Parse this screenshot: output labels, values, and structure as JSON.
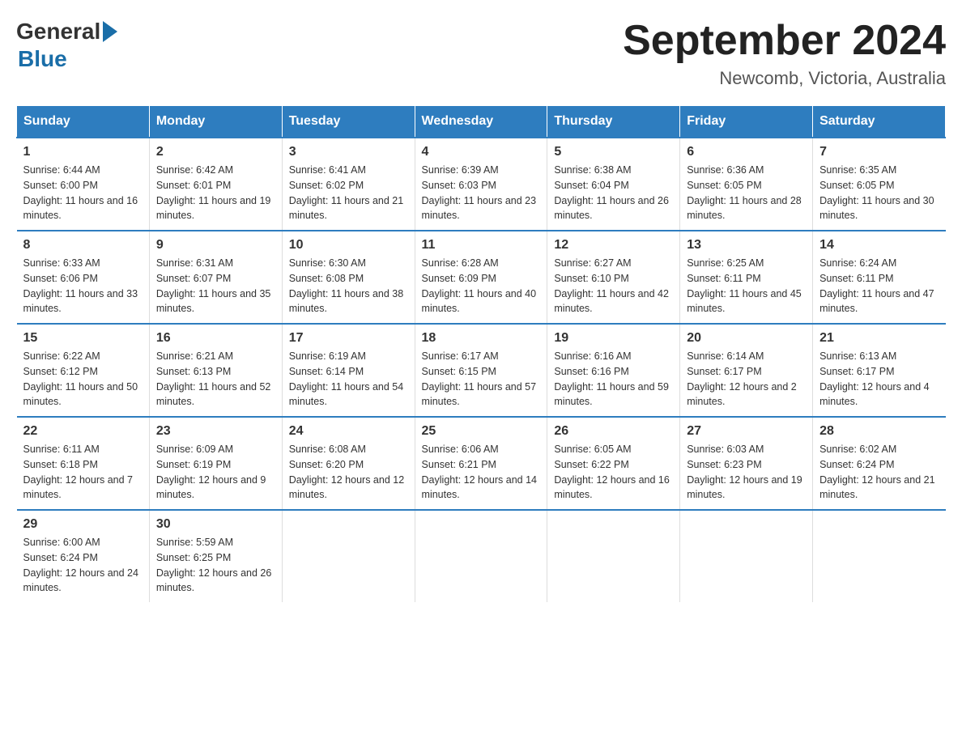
{
  "logo": {
    "text_general": "General",
    "text_blue": "Blue"
  },
  "title": "September 2024",
  "location": "Newcomb, Victoria, Australia",
  "days_header": [
    "Sunday",
    "Monday",
    "Tuesday",
    "Wednesday",
    "Thursday",
    "Friday",
    "Saturday"
  ],
  "weeks": [
    [
      {
        "num": "1",
        "sunrise": "6:44 AM",
        "sunset": "6:00 PM",
        "daylight": "11 hours and 16 minutes."
      },
      {
        "num": "2",
        "sunrise": "6:42 AM",
        "sunset": "6:01 PM",
        "daylight": "11 hours and 19 minutes."
      },
      {
        "num": "3",
        "sunrise": "6:41 AM",
        "sunset": "6:02 PM",
        "daylight": "11 hours and 21 minutes."
      },
      {
        "num": "4",
        "sunrise": "6:39 AM",
        "sunset": "6:03 PM",
        "daylight": "11 hours and 23 minutes."
      },
      {
        "num": "5",
        "sunrise": "6:38 AM",
        "sunset": "6:04 PM",
        "daylight": "11 hours and 26 minutes."
      },
      {
        "num": "6",
        "sunrise": "6:36 AM",
        "sunset": "6:05 PM",
        "daylight": "11 hours and 28 minutes."
      },
      {
        "num": "7",
        "sunrise": "6:35 AM",
        "sunset": "6:05 PM",
        "daylight": "11 hours and 30 minutes."
      }
    ],
    [
      {
        "num": "8",
        "sunrise": "6:33 AM",
        "sunset": "6:06 PM",
        "daylight": "11 hours and 33 minutes."
      },
      {
        "num": "9",
        "sunrise": "6:31 AM",
        "sunset": "6:07 PM",
        "daylight": "11 hours and 35 minutes."
      },
      {
        "num": "10",
        "sunrise": "6:30 AM",
        "sunset": "6:08 PM",
        "daylight": "11 hours and 38 minutes."
      },
      {
        "num": "11",
        "sunrise": "6:28 AM",
        "sunset": "6:09 PM",
        "daylight": "11 hours and 40 minutes."
      },
      {
        "num": "12",
        "sunrise": "6:27 AM",
        "sunset": "6:10 PM",
        "daylight": "11 hours and 42 minutes."
      },
      {
        "num": "13",
        "sunrise": "6:25 AM",
        "sunset": "6:11 PM",
        "daylight": "11 hours and 45 minutes."
      },
      {
        "num": "14",
        "sunrise": "6:24 AM",
        "sunset": "6:11 PM",
        "daylight": "11 hours and 47 minutes."
      }
    ],
    [
      {
        "num": "15",
        "sunrise": "6:22 AM",
        "sunset": "6:12 PM",
        "daylight": "11 hours and 50 minutes."
      },
      {
        "num": "16",
        "sunrise": "6:21 AM",
        "sunset": "6:13 PM",
        "daylight": "11 hours and 52 minutes."
      },
      {
        "num": "17",
        "sunrise": "6:19 AM",
        "sunset": "6:14 PM",
        "daylight": "11 hours and 54 minutes."
      },
      {
        "num": "18",
        "sunrise": "6:17 AM",
        "sunset": "6:15 PM",
        "daylight": "11 hours and 57 minutes."
      },
      {
        "num": "19",
        "sunrise": "6:16 AM",
        "sunset": "6:16 PM",
        "daylight": "11 hours and 59 minutes."
      },
      {
        "num": "20",
        "sunrise": "6:14 AM",
        "sunset": "6:17 PM",
        "daylight": "12 hours and 2 minutes."
      },
      {
        "num": "21",
        "sunrise": "6:13 AM",
        "sunset": "6:17 PM",
        "daylight": "12 hours and 4 minutes."
      }
    ],
    [
      {
        "num": "22",
        "sunrise": "6:11 AM",
        "sunset": "6:18 PM",
        "daylight": "12 hours and 7 minutes."
      },
      {
        "num": "23",
        "sunrise": "6:09 AM",
        "sunset": "6:19 PM",
        "daylight": "12 hours and 9 minutes."
      },
      {
        "num": "24",
        "sunrise": "6:08 AM",
        "sunset": "6:20 PM",
        "daylight": "12 hours and 12 minutes."
      },
      {
        "num": "25",
        "sunrise": "6:06 AM",
        "sunset": "6:21 PM",
        "daylight": "12 hours and 14 minutes."
      },
      {
        "num": "26",
        "sunrise": "6:05 AM",
        "sunset": "6:22 PM",
        "daylight": "12 hours and 16 minutes."
      },
      {
        "num": "27",
        "sunrise": "6:03 AM",
        "sunset": "6:23 PM",
        "daylight": "12 hours and 19 minutes."
      },
      {
        "num": "28",
        "sunrise": "6:02 AM",
        "sunset": "6:24 PM",
        "daylight": "12 hours and 21 minutes."
      }
    ],
    [
      {
        "num": "29",
        "sunrise": "6:00 AM",
        "sunset": "6:24 PM",
        "daylight": "12 hours and 24 minutes."
      },
      {
        "num": "30",
        "sunrise": "5:59 AM",
        "sunset": "6:25 PM",
        "daylight": "12 hours and 26 minutes."
      },
      {
        "num": "",
        "sunrise": "",
        "sunset": "",
        "daylight": ""
      },
      {
        "num": "",
        "sunrise": "",
        "sunset": "",
        "daylight": ""
      },
      {
        "num": "",
        "sunrise": "",
        "sunset": "",
        "daylight": ""
      },
      {
        "num": "",
        "sunrise": "",
        "sunset": "",
        "daylight": ""
      },
      {
        "num": "",
        "sunrise": "",
        "sunset": "",
        "daylight": ""
      }
    ]
  ]
}
